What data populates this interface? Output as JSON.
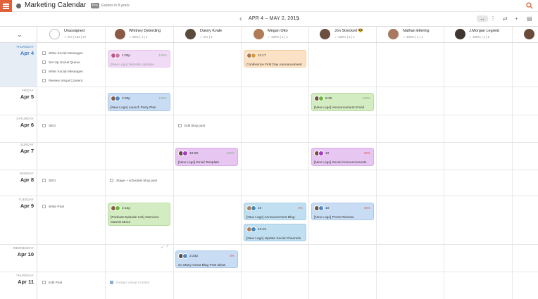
{
  "app": {
    "title": "Marketing Calendar",
    "all_label": "All",
    "pro_badge": "Pro",
    "expires": "Expires in 8 years"
  },
  "header": {
    "date_range": "APR 4 – MAY 2, 2019",
    "prev_icon": "chevron-left-icon",
    "next_icon": "chevron-right-icon"
  },
  "users": [
    {
      "name": "Unassigned",
      "stats": "✓ 0%  |  163  |  27"
    },
    {
      "name": "Whitney Deterding",
      "stats": "✓ 50%  |  1  |  1"
    },
    {
      "name": "Danny Kvale",
      "stats": "✓ 0%  |  1"
    },
    {
      "name": "Megan Otto",
      "stats": "✓ 100%  |  1  |  1"
    },
    {
      "name": "Jon Streckert 😎",
      "stats": "✓ 100%  |  1  |  1"
    },
    {
      "name": "Nathan Ellering",
      "stats": "✓ 100%  |  1  |  1"
    },
    {
      "name": "J.Morgan Legreid",
      "stats": "✓ 100%  |  1  |  1"
    }
  ],
  "days": [
    {
      "name": "THURSDAY",
      "date": "Apr 4"
    },
    {
      "name": "FRIDAY",
      "date": "Apr 5"
    },
    {
      "name": "SATURDAY",
      "date": "Apr 6"
    },
    {
      "name": "SUNDAY",
      "date": "Apr 7"
    },
    {
      "name": "MONDAY",
      "date": "Apr 8"
    },
    {
      "name": "TUESDAY",
      "date": "Apr 9"
    },
    {
      "name": "WEDNESDAY",
      "date": "Apr 10"
    },
    {
      "name": "THURSDAY",
      "date": "Apr 11"
    }
  ],
  "tasks": {
    "apr4": [
      "Write Social Messages",
      "Set Up Social Queue",
      "Write Social Messages",
      "Review Visual Content"
    ],
    "apr6_unassigned": "SEO",
    "apr6_danny": "Edit blog post",
    "apr8_unassigned": "SEO",
    "apr8_whitney": "Stage + schedule blog post",
    "apr9_unassigned": "Write Post",
    "apr11_unassigned": "Edit Post",
    "apr11_whitney": "Design Visual Content"
  },
  "cards": {
    "c1": {
      "time": "1:00p",
      "pct": "100%",
      "title": "[New Logo] Website Updates"
    },
    "c2": {
      "time": "11:17",
      "title": "Conference First Day Announcement"
    },
    "c3": {
      "time": "2:30p",
      "pct": "100%",
      "title": "[New Logo] Launch Party Plan"
    },
    "c4": {
      "time": "6:30",
      "pct": "100%",
      "title": "[New Logo] Announcement Email"
    },
    "c5": {
      "time": "10:28",
      "pct": "100%",
      "title": "[New Logo] Email Template"
    },
    "c6": {
      "time": "10",
      "pct": "50%",
      "title": "[New Logo] Social Announcements"
    },
    "c7": {
      "time": "2:13p",
      "title": "[Podcast Episode 241] Interview Garrett Moon"
    },
    "c8": {
      "time": "10",
      "pct": "0%",
      "title": "[New Logo] Announcement Blog"
    },
    "c9": {
      "time": "10",
      "pct": "50%",
      "title": "[New Logo] Press Release"
    },
    "c10": {
      "time": "10:15",
      "title": "[New Logo] Update Social Channels"
    },
    "c11": {
      "time": "2:34p",
      "pct": "0%",
      "title": "So Many Great Blog Post Ideas"
    }
  }
}
